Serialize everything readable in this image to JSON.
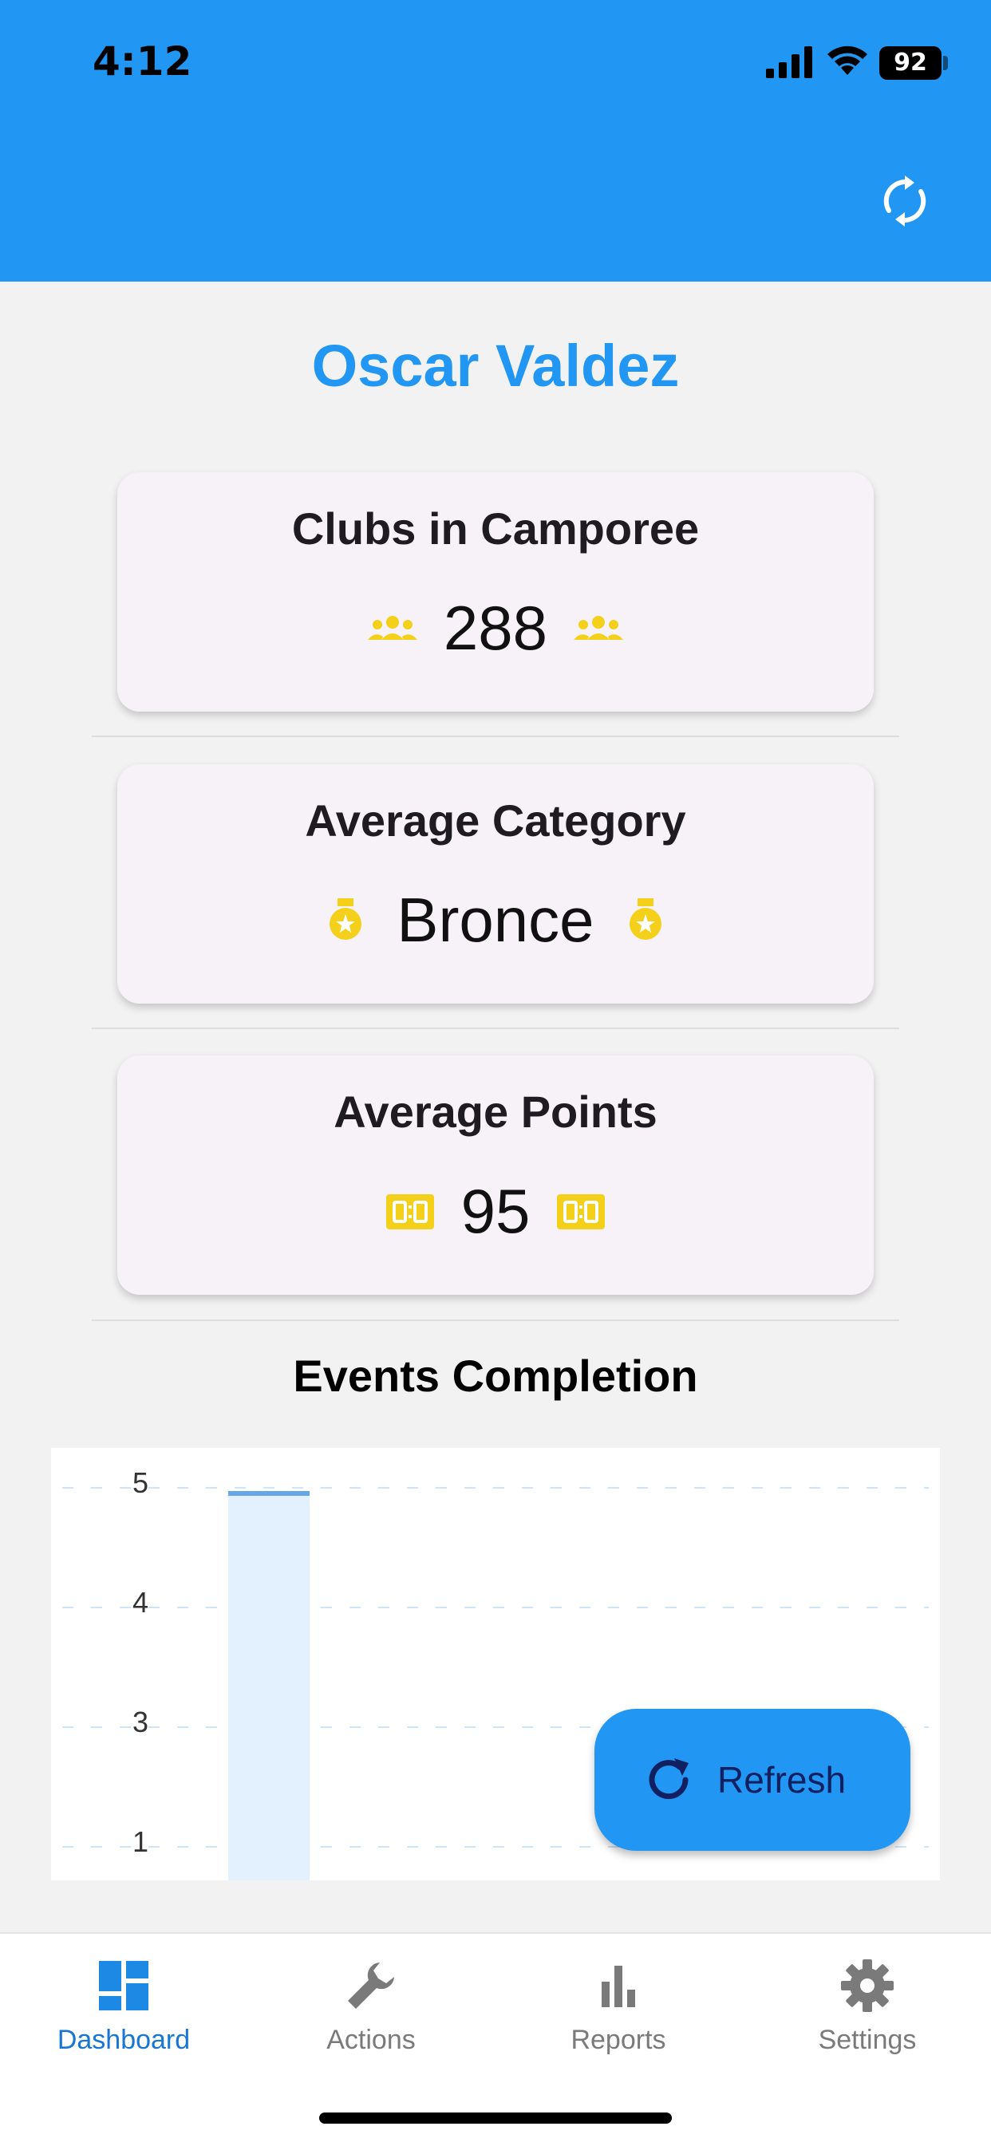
{
  "status_bar": {
    "time": "4:12",
    "battery": "92"
  },
  "header": {
    "title": "Oscar Valdez"
  },
  "cards": [
    {
      "title": "Clubs in Camporee",
      "value": "288",
      "icon": "groups-icon"
    },
    {
      "title": "Average Category",
      "value": "Bronce",
      "icon": "medal-icon"
    },
    {
      "title": "Average Points",
      "value": "95",
      "icon": "scoreboard-icon"
    }
  ],
  "chart_section": {
    "title": "Events Completion"
  },
  "chart_data": {
    "type": "bar",
    "title": "Events Completion",
    "y_ticks": [
      "5",
      "4",
      "3",
      "1"
    ],
    "ylim": [
      1,
      5
    ],
    "values": [
      5
    ],
    "categories": [
      ""
    ],
    "grid": "dashed-horizontal",
    "colors": {
      "bar_fill": "#e3f0fd",
      "bar_top": "#64a8ea",
      "grid": "#cfe4f8"
    }
  },
  "fab": {
    "label": "Refresh",
    "icon": "refresh-icon"
  },
  "bottom_nav": {
    "items": [
      {
        "label": "Dashboard",
        "icon": "dashboard-icon",
        "active": true
      },
      {
        "label": "Actions",
        "icon": "wrench-icon",
        "active": false
      },
      {
        "label": "Reports",
        "icon": "bar-chart-icon",
        "active": false
      },
      {
        "label": "Settings",
        "icon": "gear-icon",
        "active": false
      }
    ]
  },
  "colors": {
    "primary": "#2196f3",
    "accent_yellow": "#f5d01a",
    "background": "#f2f2f2",
    "card": "#f6f2f8"
  }
}
